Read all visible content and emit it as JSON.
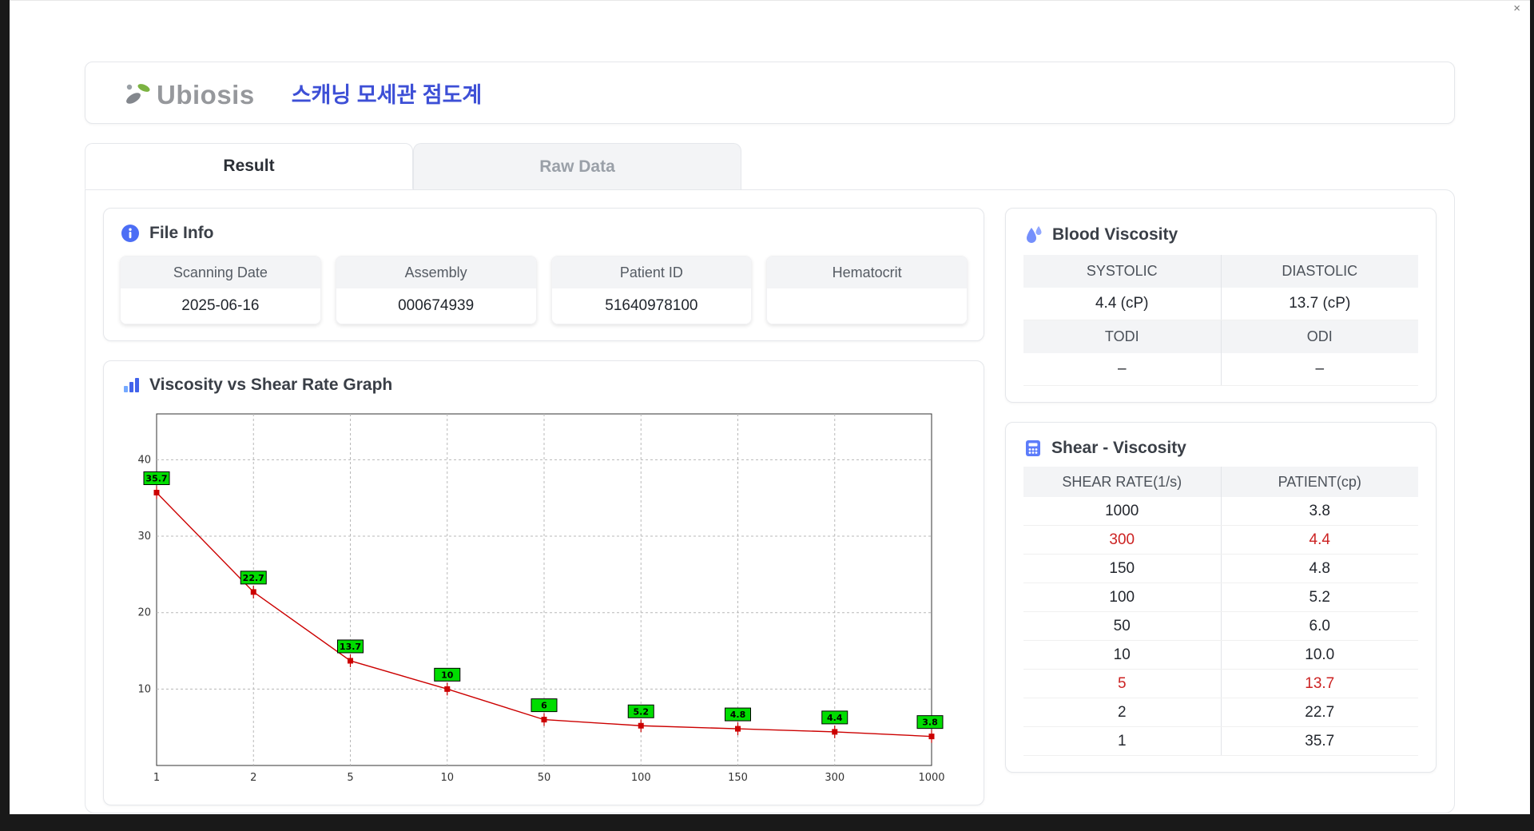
{
  "palette": {
    "title-blue": "#3d4fd6",
    "accent-red": "#cc2222",
    "icon-blue": "#5c7cfa",
    "header-gray": "#f3f4f6",
    "card-border": "#e5e7eb"
  },
  "window": {
    "close_label": "×"
  },
  "header": {
    "logo_text": "Ubiosis",
    "title": "스캐닝 모세관 점도계"
  },
  "tabs": [
    {
      "label": "Result",
      "active": true
    },
    {
      "label": "Raw Data",
      "active": false
    }
  ],
  "file_info": {
    "title": "File Info",
    "fields": [
      {
        "label": "Scanning Date",
        "value": "2025-06-16"
      },
      {
        "label": "Assembly",
        "value": "000674939"
      },
      {
        "label": "Patient ID",
        "value": "51640978100"
      },
      {
        "label": "Hematocrit",
        "value": ""
      }
    ]
  },
  "blood_viscosity": {
    "title": "Blood Viscosity",
    "groups": [
      {
        "headers": [
          "SYSTOLIC",
          "DIASTOLIC"
        ],
        "values": [
          "4.4 (cP)",
          "13.7 (cP)"
        ]
      },
      {
        "headers": [
          "TODI",
          "ODI"
        ],
        "values": [
          "–",
          "–"
        ]
      }
    ]
  },
  "graph": {
    "title": "Viscosity vs Shear Rate Graph"
  },
  "chart_data": {
    "type": "line",
    "title": "Viscosity vs Shear Rate Graph",
    "x": [
      1,
      2,
      5,
      10,
      50,
      100,
      150,
      300,
      1000
    ],
    "x_tick_labels": [
      "1",
      "2",
      "5",
      "10",
      "50",
      "100",
      "150",
      "300",
      "1000"
    ],
    "x_axis_type": "categorical-even-spacing (log-like)",
    "values": [
      35.7,
      22.7,
      13.7,
      10,
      6,
      5.2,
      4.8,
      4.4,
      3.8
    ],
    "point_labels": [
      "35.7",
      "22.7",
      "13.7",
      "10",
      "6",
      "5.2",
      "4.8",
      "4.4",
      "3.8"
    ],
    "yticks": [
      10,
      20,
      30,
      40
    ],
    "ylim": [
      0,
      46
    ],
    "grid": "dashed",
    "legend": "none",
    "line_color": "#cc0000",
    "marker_color": "#cc0000",
    "label_bg": "#00dd00",
    "xlabel": "",
    "ylabel": ""
  },
  "shear_viscosity": {
    "title": "Shear - Viscosity",
    "columns": [
      "SHEAR RATE(1/s)",
      "PATIENT(cp)"
    ],
    "rows": [
      {
        "shear": "1000",
        "patient": "3.8",
        "highlight": false
      },
      {
        "shear": "300",
        "patient": "4.4",
        "highlight": true
      },
      {
        "shear": "150",
        "patient": "4.8",
        "highlight": false
      },
      {
        "shear": "100",
        "patient": "5.2",
        "highlight": false
      },
      {
        "shear": "50",
        "patient": "6.0",
        "highlight": false
      },
      {
        "shear": "10",
        "patient": "10.0",
        "highlight": false
      },
      {
        "shear": "5",
        "patient": "13.7",
        "highlight": true
      },
      {
        "shear": "2",
        "patient": "22.7",
        "highlight": false
      },
      {
        "shear": "1",
        "patient": "35.7",
        "highlight": false
      }
    ]
  }
}
